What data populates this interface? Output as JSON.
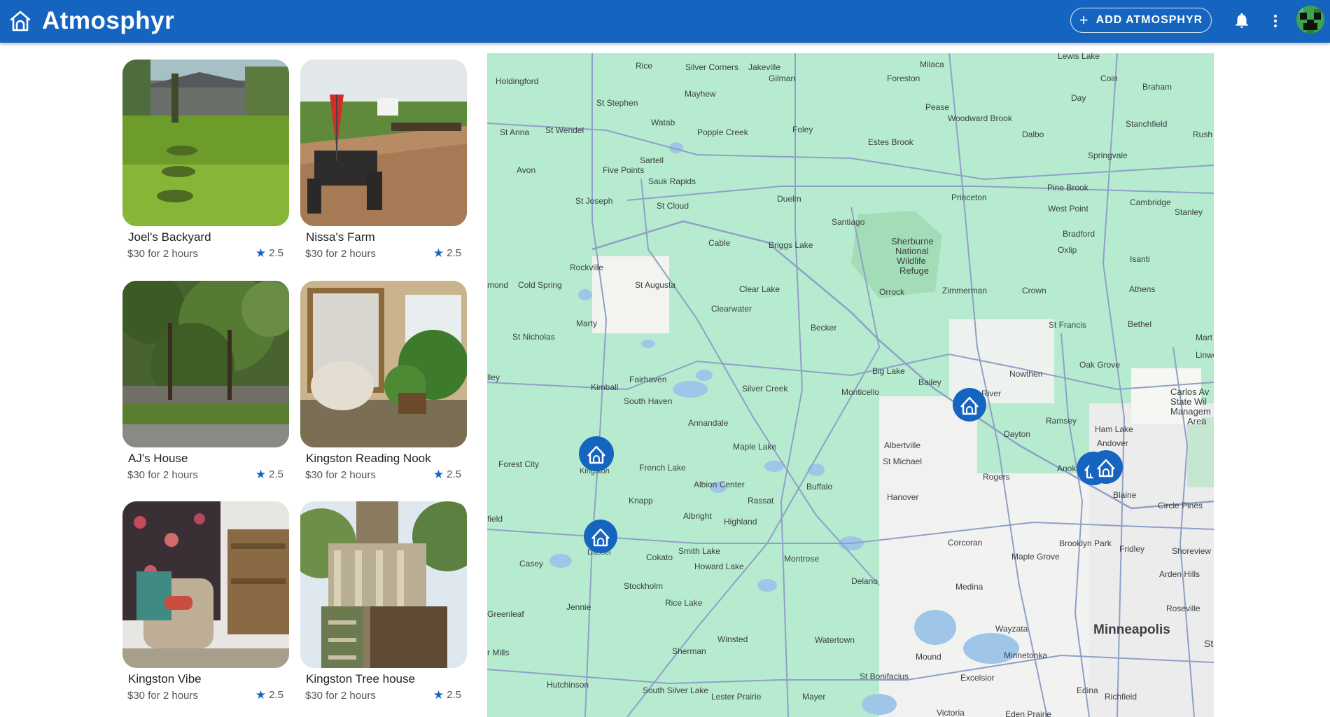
{
  "app": {
    "title": "Atmosphyr"
  },
  "header": {
    "add_button_label": "ADD ATMOSPHYR",
    "add_button_icon": "plus-icon",
    "notifications_icon": "bell-icon",
    "menu_icon": "more-vert-icon",
    "brand_color": "#1565c0"
  },
  "listings": [
    {
      "name": "Joel's Backyard",
      "price": "$30 for 2 hours",
      "rating": "2.5"
    },
    {
      "name": "Nissa's Farm",
      "price": "$30 for 2 hours",
      "rating": "2.5"
    },
    {
      "name": "AJ's House",
      "price": "$30 for 2 hours",
      "rating": "2.5"
    },
    {
      "name": "Kingston Reading Nook",
      "price": "$30 for 2 hours",
      "rating": "2.5"
    },
    {
      "name": "Kingston Vibe",
      "price": "$30 for 2 hours",
      "rating": "2.5"
    },
    {
      "name": "Kingston Tree house",
      "price": "$30 for 2 hours",
      "rating": "2.5"
    }
  ],
  "map": {
    "marker_icon": "home-marker-icon",
    "marker_color": "#1565c0",
    "labels": {
      "rice": "Rice",
      "silver_corners": "Silver Corners",
      "jakeville": "Jakeville",
      "gilman": "Gilman",
      "milaca": "Milaca",
      "foreston": "Foreston",
      "lewis_lake": "Lewis Lake",
      "coin": "Coin",
      "braham": "Braham",
      "holdingford": "Holdingford",
      "mayhew": "Mayhew",
      "st_stephen": "St Stephen",
      "pease": "Pease",
      "day": "Day",
      "woodward_brook": "Woodward Brook",
      "watab": "Watab",
      "st_anna": "St Anna",
      "st_wendel": "St Wendel",
      "popple_creek": "Popple Creek",
      "foley": "Foley",
      "dalbo": "Dalbo",
      "stanchfield": "Stanchfield",
      "rush": "Rush",
      "estes_brook": "Estes Brook",
      "springvale": "Springvale",
      "sartell": "Sartell",
      "avon": "Avon",
      "five_points": "Five Points",
      "sauk_rapids": "Sauk Rapids",
      "pine_brook": "Pine Brook",
      "st_joseph": "St Joseph",
      "st_cloud": "St Cloud",
      "duelm": "Duelm",
      "princeton": "Princeton",
      "cambridge": "Cambridge",
      "west_point": "West Point",
      "stanley": "Stanley",
      "santiago": "Santiago",
      "sherburne": "Sherburne",
      "national": "National",
      "wildlife": "Wildlife",
      "refuge": "Refuge",
      "bradford": "Bradford",
      "cable": "Cable",
      "briggs_lake": "Briggs Lake",
      "oxlip": "Oxlip",
      "rockville": "Rockville",
      "isanti": "Isanti",
      "cold_spring": "Cold Spring",
      "edmond": "mond",
      "st_augusta": "St Augusta",
      "clear_lake": "Clear Lake",
      "orrock": "Orrock",
      "zimmerman": "Zimmerman",
      "crown": "Crown",
      "athens": "Athens",
      "clearwater": "Clearwater",
      "marty": "Marty",
      "becker": "Becker",
      "st_francis": "St Francis",
      "bethel": "Bethel",
      "mart": "Mart",
      "st_nicholas": "St Nicholas",
      "linwood": "Linwo",
      "big_lake": "Big Lake",
      "oak_grove": "Oak Grove",
      "fairhaven": "Fairhaven",
      "nowthen": "Nowthen",
      "valley": "lley",
      "bailey": "Bailey",
      "kimball": "Kimball",
      "silver_creek": "Silver Creek",
      "monticello": "Monticello",
      "river": "River",
      "carlos_avery": "Carlos Av",
      "wildlife2": "State Wil",
      "management": "Managem",
      "area": "Area",
      "south_haven": "South Haven",
      "ramsey": "Ramsey",
      "annandale": "Annandale",
      "ham_lake": "Ham Lake",
      "dayton": "Dayton",
      "albertville": "Albertville",
      "andover": "Andover",
      "maple_lake": "Maple Lake",
      "st_michael": "St Michael",
      "forest_city": "Forest City",
      "kingston": "Kingston",
      "french_lake": "French Lake",
      "anoka": "Anoka",
      "rogers": "Rogers",
      "albion_center": "Albion Center",
      "buffalo": "Buffalo",
      "blaine": "Blaine",
      "hanover": "Hanover",
      "knapp": "Knapp",
      "rassat": "Rassat",
      "circle_pines": "Circle Pines",
      "litchfield": "field",
      "albright": "Albright",
      "highland": "Highland",
      "corcoran": "Corcoran",
      "brooklyn_park": "Brooklyn Park",
      "dassel": "Dassel",
      "fridley": "Fridley",
      "shoreview": "Shoreview",
      "casey": "Casey",
      "cokato": "Cokato",
      "smith_lake": "Smith Lake",
      "montrose": "Montrose",
      "maple_grove": "Maple Grove",
      "howard_lake": "Howard Lake",
      "arden_hills": "Arden Hills",
      "delano": "Delano",
      "stockholm": "Stockholm",
      "medina": "Medina",
      "rice_lake": "Rice Lake",
      "jennie": "Jennie",
      "roseville": "Roseville",
      "greenleaf": "Greenleaf",
      "wayzata": "Wayzata",
      "minneapolis": "Minneapolis",
      "st_paul": "St",
      "winsted": "Winsted",
      "watertown": "Watertown",
      "sherman": "Sherman",
      "mills": "r Mills",
      "mound": "Mound",
      "minnetonka": "Minnetonka",
      "south_silver_lake": "South Silver Lake",
      "hutchinson": "Hutchinson",
      "st_bonifacius": "St Bonifacius",
      "excelsior": "Excelsior",
      "lester_prairie": "Lester Prairie",
      "mayer": "Mayer",
      "edina": "Edina",
      "richfield": "Richfield",
      "victoria": "Victoria",
      "eden_prairie": "Eden Prairie"
    }
  }
}
